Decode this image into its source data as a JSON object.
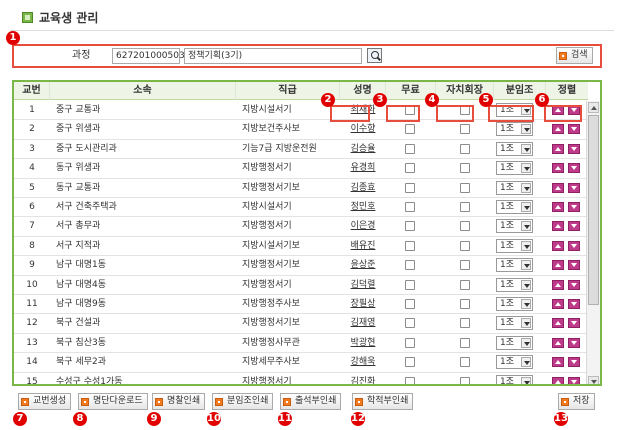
{
  "page": {
    "title": "교육생 관리"
  },
  "search": {
    "label": "과정",
    "course_code": "627201000503",
    "course_name": "정책기획(3기)",
    "search_button": "검색"
  },
  "markers": [
    "1",
    "2",
    "3",
    "4",
    "5",
    "6",
    "7",
    "8",
    "9",
    "10",
    "11",
    "12",
    "13"
  ],
  "table": {
    "headers": [
      "교번",
      "소속",
      "직급",
      "성명",
      "무료",
      "자치회장",
      "분임조",
      "정렬"
    ],
    "rows": [
      {
        "no": "1",
        "dept": "중구 교통과",
        "rank": "지방시설서기",
        "name": "최재화",
        "group": "1조"
      },
      {
        "no": "2",
        "dept": "중구 위생과",
        "rank": "지방보건주사보",
        "name": "이수향",
        "group": "1조"
      },
      {
        "no": "3",
        "dept": "중구 도시관리과",
        "rank": "기능7급 지방운전원",
        "name": "김승율",
        "group": "1조"
      },
      {
        "no": "4",
        "dept": "동구 위생과",
        "rank": "지방행정서기",
        "name": "유경희",
        "group": "1조"
      },
      {
        "no": "5",
        "dept": "동구 교통과",
        "rank": "지방행정서기보",
        "name": "김종효",
        "group": "1조"
      },
      {
        "no": "6",
        "dept": "서구 건축주택과",
        "rank": "지방시설서기",
        "name": "정민호",
        "group": "1조"
      },
      {
        "no": "7",
        "dept": "서구 총무과",
        "rank": "지방행정서기",
        "name": "이은경",
        "group": "1조"
      },
      {
        "no": "8",
        "dept": "서구 지적과",
        "rank": "지방시설서기보",
        "name": "배유진",
        "group": "1조"
      },
      {
        "no": "9",
        "dept": "남구 대명1동",
        "rank": "지방행정서기보",
        "name": "윤상준",
        "group": "1조"
      },
      {
        "no": "10",
        "dept": "남구 대명4동",
        "rank": "지방행정서기",
        "name": "김덕렬",
        "group": "1조"
      },
      {
        "no": "11",
        "dept": "남구 대명9동",
        "rank": "지방행정주사보",
        "name": "장필상",
        "group": "1조"
      },
      {
        "no": "12",
        "dept": "북구 건설과",
        "rank": "지방행정서기보",
        "name": "김재영",
        "group": "1조"
      },
      {
        "no": "13",
        "dept": "북구 침산3동",
        "rank": "지방행정사무관",
        "name": "박광현",
        "group": "1조"
      },
      {
        "no": "14",
        "dept": "북구 세무2과",
        "rank": "지방세무주사보",
        "name": "강해욱",
        "group": "1조"
      },
      {
        "no": "15",
        "dept": "수성구 수성1가동",
        "rank": "지방행정서기",
        "name": "김진화",
        "group": "1조"
      }
    ]
  },
  "footer": {
    "serial_button": "교번생성",
    "download_button": "명단다운로드",
    "roster_button": "명찰인쇄",
    "group_print_button": "분임조인쇄",
    "attendance_print_button": "출석부인쇄",
    "record_print_button": "학적부인쇄",
    "save_button": "저장"
  },
  "colors": {
    "marker": "#e10000",
    "highlight": "#e74c3c",
    "grid_border": "#7ab648",
    "button_icon": "#f07a1e",
    "sort_button": "#c03a8a"
  }
}
